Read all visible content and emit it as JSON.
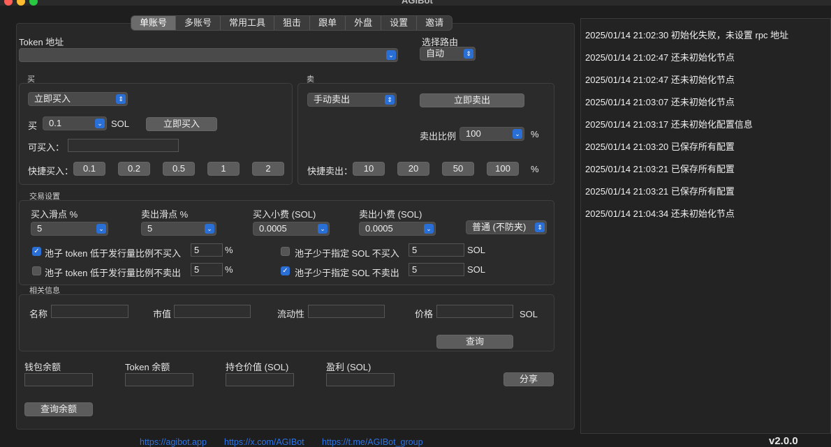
{
  "window": {
    "title": "AGIBot"
  },
  "colors": {
    "accent": "#2a6fd6",
    "link": "#2d74e6"
  },
  "tabs": [
    "单账号",
    "多账号",
    "常用工具",
    "狙击",
    "跟单",
    "外盘",
    "设置",
    "邀请"
  ],
  "token": {
    "label": "Token 地址",
    "value": ""
  },
  "route": {
    "label": "选择路由",
    "value": "自动"
  },
  "buy": {
    "title": "买",
    "mode": "立即买入",
    "amount_label": "买",
    "amount": "0.1",
    "unit": "SOL",
    "buy_button": "立即买入",
    "available_label": "可买入：",
    "available_value": "",
    "quick_label": "快捷买入：",
    "quick": [
      "0.1",
      "0.2",
      "0.5",
      "1",
      "2"
    ]
  },
  "sell": {
    "title": "卖",
    "mode": "手动卖出",
    "sell_button": "立即卖出",
    "ratio_label": "卖出比例",
    "ratio": "100",
    "pct": "%",
    "quick_label": "快捷卖出：",
    "quick": [
      "10",
      "20",
      "50",
      "100"
    ],
    "quick_pct": "%"
  },
  "trade": {
    "title": "交易设置",
    "buy_slip_label": "买入滑点 %",
    "buy_slip": "5",
    "sell_slip_label": "卖出滑点 %",
    "sell_slip": "5",
    "buy_fee_label": "买入小费 (SOL)",
    "buy_fee": "0.0005",
    "sell_fee_label": "卖出小费 (SOL)",
    "sell_fee": "0.0005",
    "mev_mode": "普通 (不防夹)",
    "checks": [
      {
        "label": "池子 token 低于发行量比例不买入",
        "value": "5",
        "unit": "%",
        "checked": true
      },
      {
        "label": "池子 token 低于发行量比例不卖出",
        "value": "5",
        "unit": "%",
        "checked": false
      },
      {
        "label": "池子少于指定 SOL 不买入",
        "value": "5",
        "unit": "SOL",
        "checked": false
      },
      {
        "label": "池子少于指定 SOL 不卖出",
        "value": "5",
        "unit": "SOL",
        "checked": true
      }
    ]
  },
  "info": {
    "title": "相关信息",
    "name_label": "名称",
    "mcap_label": "市值",
    "liquidity_label": "流动性",
    "price_label": "价格",
    "price_unit": "SOL",
    "query_button": "查询"
  },
  "balances": {
    "wallet_label": "钱包余额",
    "token_label": "Token 余额",
    "position_label": "持仓价值 (SOL)",
    "profit_label": "盈利 (SOL)",
    "share_button": "分享",
    "query_button": "查询余额"
  },
  "links": [
    "https://agibot.app",
    "https://x.com/AGIBot",
    "https://t.me/AGIBot_group"
  ],
  "version": "v2.0.0",
  "log": [
    "2025/01/14 21:02:30 初始化失败，未设置 rpc 地址",
    "2025/01/14 21:02:47 还未初始化节点",
    "2025/01/14 21:02:47 还未初始化节点",
    "2025/01/14 21:03:07 还未初始化节点",
    "2025/01/14 21:03:17 还未初始化配置信息",
    "2025/01/14 21:03:20 已保存所有配置",
    "2025/01/14 21:03:21 已保存所有配置",
    "2025/01/14 21:03:21 已保存所有配置",
    "2025/01/14 21:04:34 还未初始化节点"
  ]
}
